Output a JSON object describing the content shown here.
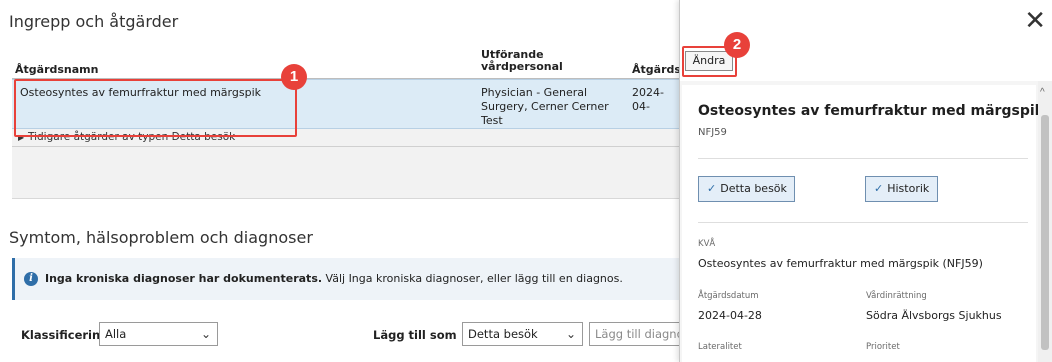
{
  "procedures": {
    "section_title": "Ingrepp och åtgärder",
    "columns": {
      "name": "Åtgärdsnamn",
      "performer": "Utförande vårdpersonal",
      "date": "Åtgärds"
    },
    "rows": [
      {
        "name": "Osteosyntes av femurfraktur med märgspik",
        "performer": "Physician - General Surgery, Cerner Cerner Test",
        "date": "2024-04-"
      }
    ],
    "group_row": "Tidigare åtgärder av typen Detta besök"
  },
  "diagnoses": {
    "section_title": "Symtom, hälsoproblem och diagnoser",
    "info_bold": "Inga kroniska diagnoser har dokumenterats.",
    "info_text": "Välj Inga kroniska diagnoser, eller lägg till en diagnos.",
    "classification_label": "Klassificering",
    "classification_value": "Alla",
    "add_as_label": "Lägg till som",
    "add_as_value": "Detta besök",
    "add_diagnosis_placeholder": "Lägg till diagnos"
  },
  "callouts": {
    "one": "1",
    "two": "2"
  },
  "panel": {
    "edit_label": "Ändra",
    "title": "Osteosyntes av femurfraktur med märgspik",
    "code": "NFJ59",
    "btn_visit": "Detta besök",
    "btn_history": "Historik",
    "kva_label": "KVÅ",
    "kva_value": "Osteosyntes av femurfraktur med märgspik (NFJ59)",
    "date_label": "Åtgärdsdatum",
    "date_value": "2024-04-28",
    "facility_label": "Vårdinrättning",
    "facility_value": "Södra Älvsborgs Sjukhus",
    "laterality_label": "Lateralitet",
    "priority_label": "Prioritet"
  },
  "colors": {
    "accent": "#2f6ea8",
    "callout": "#e8413a",
    "selected_row": "#dcebf6"
  },
  "icons": {
    "close": "close-icon",
    "info": "info-icon",
    "check": "check-icon",
    "chevron": "chevron-down-icon"
  }
}
